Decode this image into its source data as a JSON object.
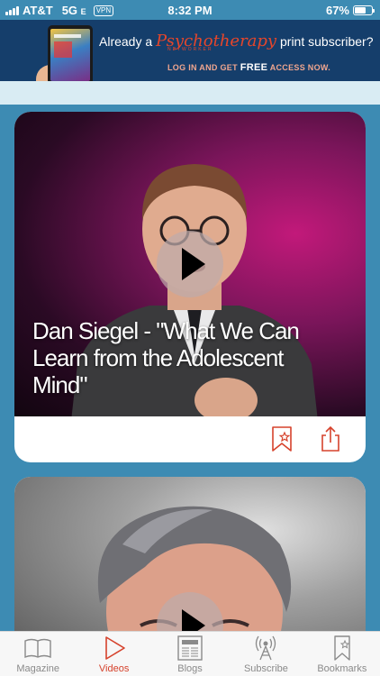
{
  "status": {
    "carrier": "AT&T",
    "network": "5G",
    "network_suffix": "E",
    "vpn": "VPN",
    "time": "8:32 PM",
    "battery": "67%",
    "battery_level": 0.67
  },
  "banner": {
    "line1_prefix": "Already a",
    "brand": "Psychotherapy",
    "brand_sub": "NETWORKER",
    "line1_suffix": "print subscriber?",
    "line2_prefix": "LOG IN AND GET",
    "line2_free": "FREE",
    "line2_suffix": "ACCESS NOW."
  },
  "feed": {
    "videos": [
      {
        "title": "Dan Siegel - \"What We Can Learn from the Adolescent Mind\""
      },
      {
        "title": ""
      }
    ]
  },
  "tabs": [
    {
      "label": "Magazine",
      "icon": "book-icon",
      "active": false
    },
    {
      "label": "Videos",
      "icon": "play-icon",
      "active": true
    },
    {
      "label": "Blogs",
      "icon": "newspaper-icon",
      "active": false
    },
    {
      "label": "Subscribe",
      "icon": "antenna-icon",
      "active": false
    },
    {
      "label": "Bookmarks",
      "icon": "bookmark-icon",
      "active": false
    }
  ],
  "colors": {
    "background": "#3d8bb3",
    "banner": "#153e6b",
    "accent": "#d6422c",
    "tab_inactive": "#8a8a8a"
  }
}
